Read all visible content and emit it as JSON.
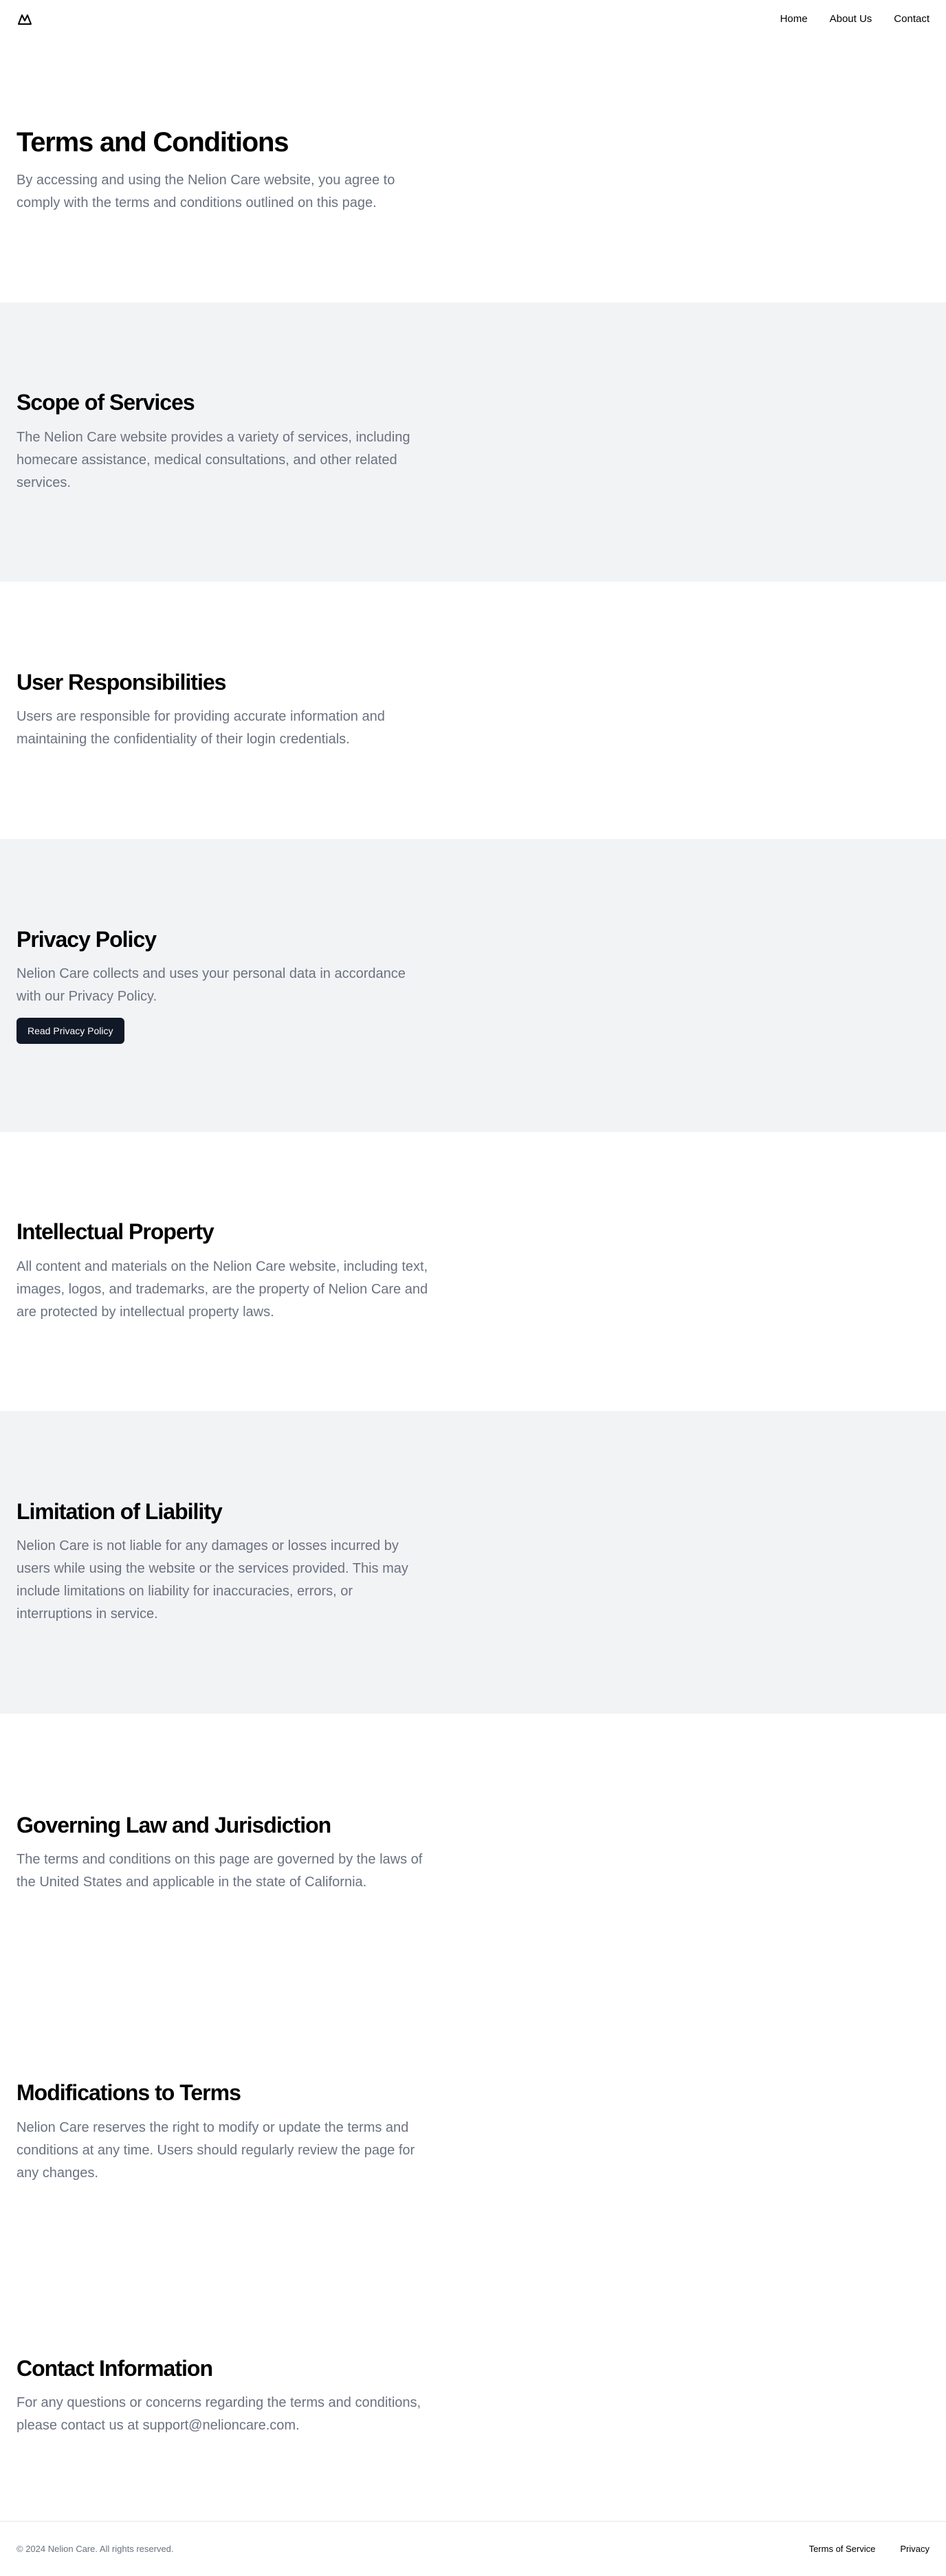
{
  "header": {
    "logo_icon": "mountain-logo-icon",
    "nav": [
      {
        "label": "Home"
      },
      {
        "label": "About Us"
      },
      {
        "label": "Contact"
      }
    ]
  },
  "sections": {
    "terms": {
      "title": "Terms and Conditions",
      "text": "By accessing and using the Nelion Care website, you agree to comply with the terms and conditions outlined on this page."
    },
    "scope": {
      "title": "Scope of Services",
      "text": "The Nelion Care website provides a variety of services, including homecare assistance, medical consultations, and other related services."
    },
    "user": {
      "title": "User Responsibilities",
      "text": "Users are responsible for providing accurate information and maintaining the confidentiality of their login credentials."
    },
    "privacy": {
      "title": "Privacy Policy",
      "text": "Nelion Care collects and uses your personal data in accordance with our Privacy Policy.",
      "button": "Read Privacy Policy"
    },
    "ip": {
      "title": "Intellectual Property",
      "text": "All content and materials on the Nelion Care website, including text, images, logos, and trademarks, are the property of Nelion Care and are protected by intellectual property laws."
    },
    "liability": {
      "title": "Limitation of Liability",
      "text": "Nelion Care is not liable for any damages or losses incurred by users while using the website or the services provided. This may include limitations on liability for inaccuracies, errors, or interruptions in service."
    },
    "law": {
      "title": "Governing Law and Jurisdiction",
      "text": "The terms and conditions on this page are governed by the laws of the United States and applicable in the state of California."
    },
    "mods": {
      "title": "Modifications to Terms",
      "text": "Nelion Care reserves the right to modify or update the terms and conditions at any time. Users should regularly review the page for any changes."
    },
    "contact": {
      "title": "Contact Information",
      "text": "For any questions or concerns regarding the terms and conditions, please contact us at support@nelioncare.com."
    }
  },
  "footer": {
    "copyright": "© 2024 Nelion Care. All rights reserved.",
    "links": [
      {
        "label": "Terms of Service"
      },
      {
        "label": "Privacy"
      }
    ]
  },
  "colors": {
    "gray_section": "#f2f3f5",
    "body_text": "#6b7280",
    "button_bg": "#111827"
  }
}
